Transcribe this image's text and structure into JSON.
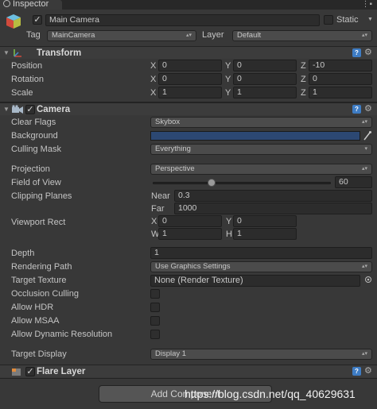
{
  "tab": {
    "title": "Inspector"
  },
  "object": {
    "name": "Main Camera",
    "static_label": "Static",
    "tag_label": "Tag",
    "tag_value": "MainCamera",
    "layer_label": "Layer",
    "layer_value": "Default"
  },
  "transform": {
    "title": "Transform",
    "rows": [
      {
        "label": "Position",
        "x": "0",
        "y": "0",
        "z": "-10"
      },
      {
        "label": "Rotation",
        "x": "0",
        "y": "0",
        "z": "0"
      },
      {
        "label": "Scale",
        "x": "1",
        "y": "1",
        "z": "1"
      }
    ],
    "axes": {
      "x": "X",
      "y": "Y",
      "z": "Z"
    }
  },
  "camera": {
    "title": "Camera",
    "clear_flags": {
      "label": "Clear Flags",
      "value": "Skybox"
    },
    "background": {
      "label": "Background",
      "color": "#2c4873"
    },
    "culling_mask": {
      "label": "Culling Mask",
      "value": "Everything"
    },
    "projection": {
      "label": "Projection",
      "value": "Perspective"
    },
    "fov": {
      "label": "Field of View",
      "value": "60"
    },
    "clipping": {
      "label": "Clipping Planes",
      "near_label": "Near",
      "near": "0.3",
      "far_label": "Far",
      "far": "1000"
    },
    "viewport": {
      "label": "Viewport Rect",
      "x_label": "X",
      "x": "0",
      "y_label": "Y",
      "y": "0",
      "w_label": "W",
      "w": "1",
      "h_label": "H",
      "h": "1"
    },
    "depth": {
      "label": "Depth",
      "value": "1"
    },
    "rendering_path": {
      "label": "Rendering Path",
      "value": "Use Graphics Settings"
    },
    "target_texture": {
      "label": "Target Texture",
      "value": "None (Render Texture)"
    },
    "occlusion_culling": {
      "label": "Occlusion Culling"
    },
    "allow_hdr": {
      "label": "Allow HDR"
    },
    "allow_msaa": {
      "label": "Allow MSAA"
    },
    "allow_dynamic_resolution": {
      "label": "Allow Dynamic Resolution"
    },
    "target_display": {
      "label": "Target Display",
      "value": "Display 1"
    }
  },
  "flare": {
    "title": "Flare Layer"
  },
  "add_component": {
    "label": "Add Component"
  },
  "watermark": "https://blog.csdn.net/qq_40629631",
  "icons": {
    "tab": "inspector-icon",
    "menu": "vertical-menu-icon",
    "object": "cube-icon",
    "transform": "transform-icon",
    "camera": "camera-icon",
    "flare": "flare-icon",
    "help": "help-icon",
    "gear": "gear-icon",
    "picker": "eyedropper-icon",
    "target": "object-picker-icon"
  },
  "colors": {
    "help": "#3e7cc4",
    "background_swatch": "#2c4873"
  }
}
